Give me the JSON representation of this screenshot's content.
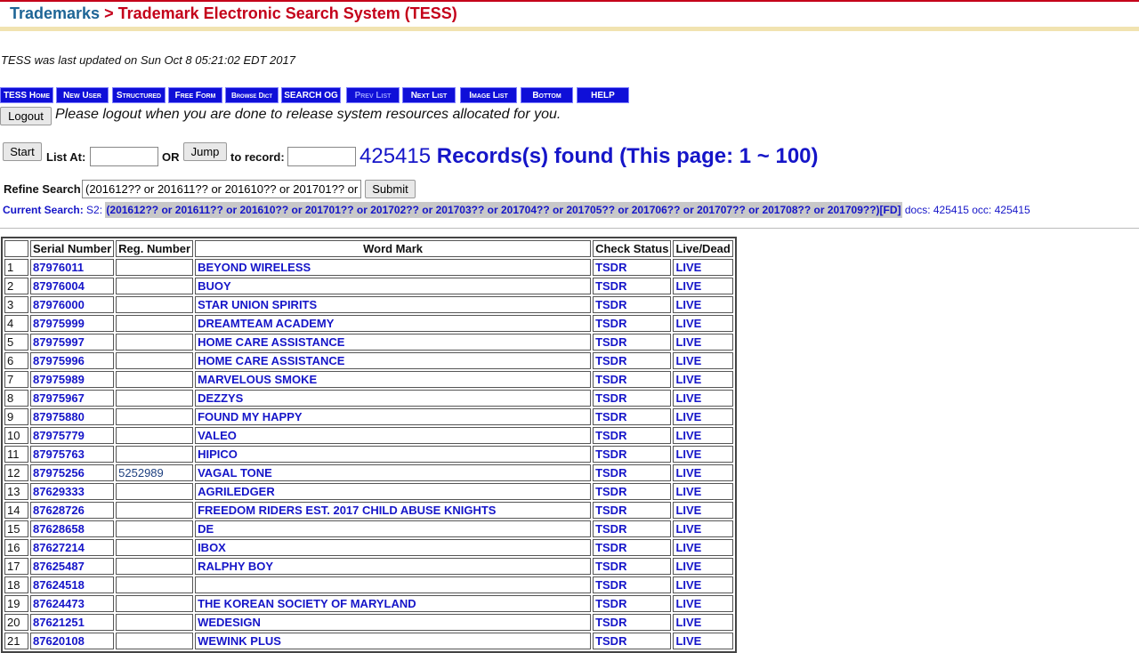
{
  "header": {
    "breadcrumb": "Trademarks",
    "separator": ">",
    "title": "Trademark Electronic Search System (TESS)"
  },
  "last_updated": "TESS was last updated on Sun Oct 8 05:21:02 EDT 2017",
  "nav": [
    {
      "label": "TESS Home"
    },
    {
      "label": "New User"
    },
    {
      "label": "Structured"
    },
    {
      "label": "Free Form"
    },
    {
      "label": "Browse Dict"
    },
    {
      "label": "SEARCH OG"
    },
    {
      "label": "Prev List"
    },
    {
      "label": "Next List"
    },
    {
      "label": "Image List"
    },
    {
      "label": "Bottom"
    },
    {
      "label": "HELP"
    }
  ],
  "logout": {
    "button": "Logout",
    "message": "Please logout when you are done to release system resources allocated for you."
  },
  "listing": {
    "start_button": "Start",
    "list_at_label": "List At:",
    "list_at_value": "",
    "or_label": "OR",
    "jump_button": "Jump",
    "to_record_label": "to record:",
    "to_record_value": "",
    "count": "425415",
    "records_text": "Records(s) found (This page: 1 ~ 100)"
  },
  "refine": {
    "label": "Refine Search",
    "value": "(201612?? or 201611?? or 201610?? or 201701?? or 201702?? or 201703?? or 201704?? or 201705?? or 201706?? or 201707?? or 201708?? or 201709??)[FD]",
    "submit": "Submit"
  },
  "current_search": {
    "label": "Current Search:",
    "set": "S2:",
    "query": "(201612?? or 201611?? or 201610?? or 201701?? or 201702?? or 201703?? or 201704?? or 201705?? or 201706?? or 201707?? or 201708?? or 201709??)[FD]",
    "stats": "docs: 425415 occ: 425415"
  },
  "table": {
    "headers": [
      "",
      "Serial Number",
      "Reg. Number",
      "Word Mark",
      "Check Status",
      "Live/Dead"
    ],
    "rows": [
      [
        "1",
        "87976011",
        "",
        "BEYOND WIRELESS",
        "TSDR",
        "LIVE"
      ],
      [
        "2",
        "87976004",
        "",
        "BUOY",
        "TSDR",
        "LIVE"
      ],
      [
        "3",
        "87976000",
        "",
        "STAR UNION SPIRITS",
        "TSDR",
        "LIVE"
      ],
      [
        "4",
        "87975999",
        "",
        "DREAMTEAM ACADEMY",
        "TSDR",
        "LIVE"
      ],
      [
        "5",
        "87975997",
        "",
        "HOME CARE ASSISTANCE",
        "TSDR",
        "LIVE"
      ],
      [
        "6",
        "87975996",
        "",
        "HOME CARE ASSISTANCE",
        "TSDR",
        "LIVE"
      ],
      [
        "7",
        "87975989",
        "",
        "MARVELOUS SMOKE",
        "TSDR",
        "LIVE"
      ],
      [
        "8",
        "87975967",
        "",
        "DEZZYS",
        "TSDR",
        "LIVE"
      ],
      [
        "9",
        "87975880",
        "",
        "FOUND MY HAPPY",
        "TSDR",
        "LIVE"
      ],
      [
        "10",
        "87975779",
        "",
        "VALEO",
        "TSDR",
        "LIVE"
      ],
      [
        "11",
        "87975763",
        "",
        "HIPICO",
        "TSDR",
        "LIVE"
      ],
      [
        "12",
        "87975256",
        "5252989",
        "VAGAL TONE",
        "TSDR",
        "LIVE"
      ],
      [
        "13",
        "87629333",
        "",
        "AGRILEDGER",
        "TSDR",
        "LIVE"
      ],
      [
        "14",
        "87628726",
        "",
        "FREEDOM RIDERS EST. 2017 CHILD ABUSE KNIGHTS",
        "TSDR",
        "LIVE"
      ],
      [
        "15",
        "87628658",
        "",
        "DE",
        "TSDR",
        "LIVE"
      ],
      [
        "16",
        "87627214",
        "",
        "IBOX",
        "TSDR",
        "LIVE"
      ],
      [
        "17",
        "87625487",
        "",
        "RALPHY BOY",
        "TSDR",
        "LIVE"
      ],
      [
        "18",
        "87624518",
        "",
        "",
        "TSDR",
        "LIVE"
      ],
      [
        "19",
        "87624473",
        "",
        "THE KOREAN SOCIETY OF MARYLAND",
        "TSDR",
        "LIVE"
      ],
      [
        "20",
        "87621251",
        "",
        "WEDESIGN",
        "TSDR",
        "LIVE"
      ],
      [
        "21",
        "87620108",
        "",
        "WEWINK PLUS",
        "TSDR",
        "LIVE"
      ]
    ]
  },
  "colors": {
    "brand_red": "#c4001a",
    "breadcrumb_blue": "#1e6596",
    "nav_blue": "#0f0fd8",
    "link_blue": "#1515c8"
  }
}
